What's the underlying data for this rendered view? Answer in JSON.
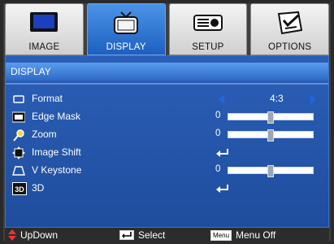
{
  "tabs": [
    {
      "label": "IMAGE",
      "icon": "monitor-icon",
      "active": false
    },
    {
      "label": "DISPLAY",
      "icon": "tv-icon",
      "active": true
    },
    {
      "label": "SETUP",
      "icon": "projector-icon",
      "active": false
    },
    {
      "label": "OPTIONS",
      "icon": "checklist-icon",
      "active": false
    }
  ],
  "panel": {
    "title": "DISPLAY",
    "rows": [
      {
        "label": "Format",
        "icon": "format-icon",
        "value": "4:3",
        "kind": "choice"
      },
      {
        "label": "Edge Mask",
        "icon": "edge-mask-icon",
        "value": "0",
        "kind": "slider",
        "slider_level": 0.5
      },
      {
        "label": "Zoom",
        "icon": "zoom-icon",
        "value": "0",
        "kind": "slider",
        "slider_level": 0.5
      },
      {
        "label": "Image Shift",
        "icon": "image-shift-icon",
        "value": "",
        "kind": "enter"
      },
      {
        "label": "V Keystone",
        "icon": "keystone-icon",
        "value": "0",
        "kind": "slider",
        "slider_level": 0.5
      },
      {
        "label": "3D",
        "icon": "3d-icon",
        "icon_text": "3D",
        "value": "",
        "kind": "enter"
      }
    ]
  },
  "footer": {
    "updown": "UpDown",
    "select": "Select",
    "menu_key": "Menu",
    "menu_off": "Menu Off"
  },
  "colors": {
    "panel": "#2456ad",
    "active_tab": "#2f78d8",
    "arrow": "#1d67e5"
  }
}
